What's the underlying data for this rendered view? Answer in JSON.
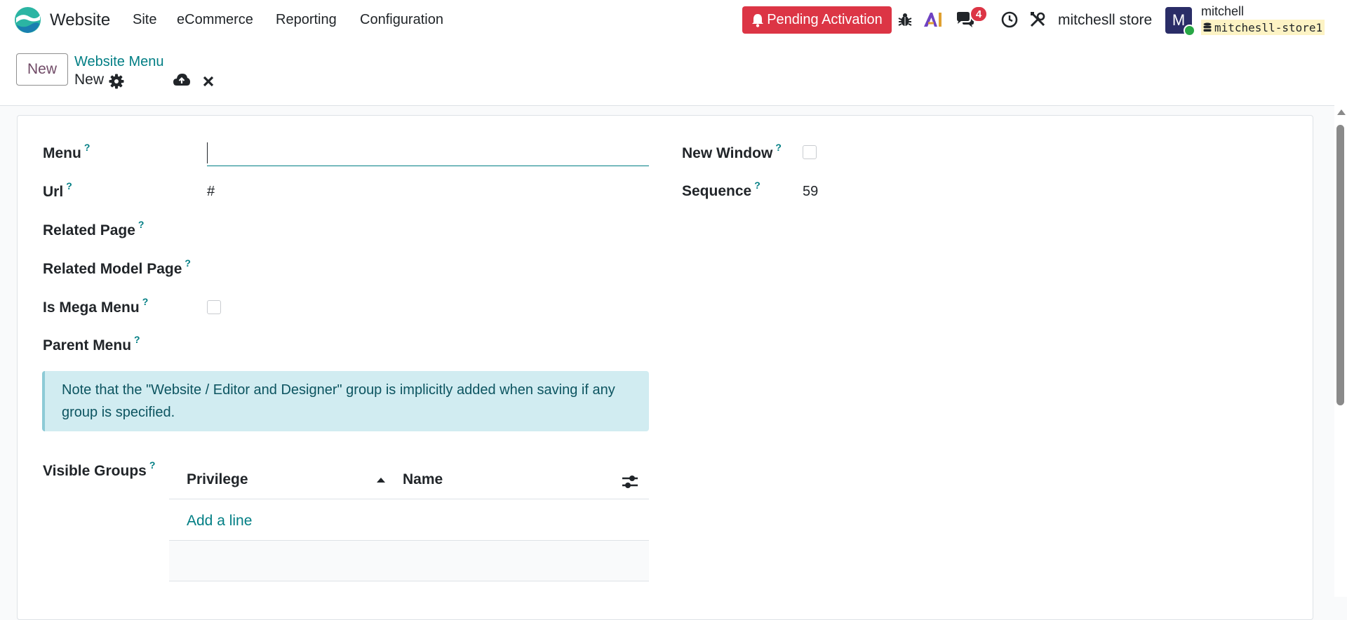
{
  "navbar": {
    "app_name": "Website",
    "menus": [
      "Site",
      "eCommerce",
      "Reporting",
      "Configuration"
    ],
    "pending_label": "Pending Activation",
    "message_count": "4",
    "company": "mitchesll store",
    "avatar_letter": "M",
    "user_name": "mitchell",
    "database": "mitchesll-store1"
  },
  "control_panel": {
    "new_button": "New",
    "breadcrumb_parent": "Website Menu",
    "breadcrumb_current": "New"
  },
  "form": {
    "menu_label": "Menu",
    "menu_value": "",
    "url_label": "Url",
    "url_value": "#",
    "related_page_label": "Related Page",
    "related_model_page_label": "Related Model Page",
    "is_mega_menu_label": "Is Mega Menu",
    "parent_menu_label": "Parent Menu",
    "new_window_label": "New Window",
    "sequence_label": "Sequence",
    "sequence_value": "59",
    "help_mark": "?",
    "alert_text": "Note that the \"Website / Editor and Designer\" group is implicitly added when saving if any group is specified.",
    "visible_groups_label": "Visible Groups",
    "table": {
      "columns": [
        "Privilege",
        "Name"
      ],
      "add_line": "Add a line"
    }
  },
  "colors": {
    "accent": "#017e84",
    "brand": "#714b67",
    "danger": "#dc3545",
    "alert_bg": "#d1ecf1"
  },
  "icons": [
    "website-logo-icon",
    "bell-icon",
    "bug-icon",
    "ai-icon",
    "chat-icon",
    "clock-icon",
    "tools-icon",
    "gear-icon",
    "cloud-upload-icon",
    "close-icon",
    "sort-up-icon",
    "column-settings-icon",
    "database-icon"
  ]
}
